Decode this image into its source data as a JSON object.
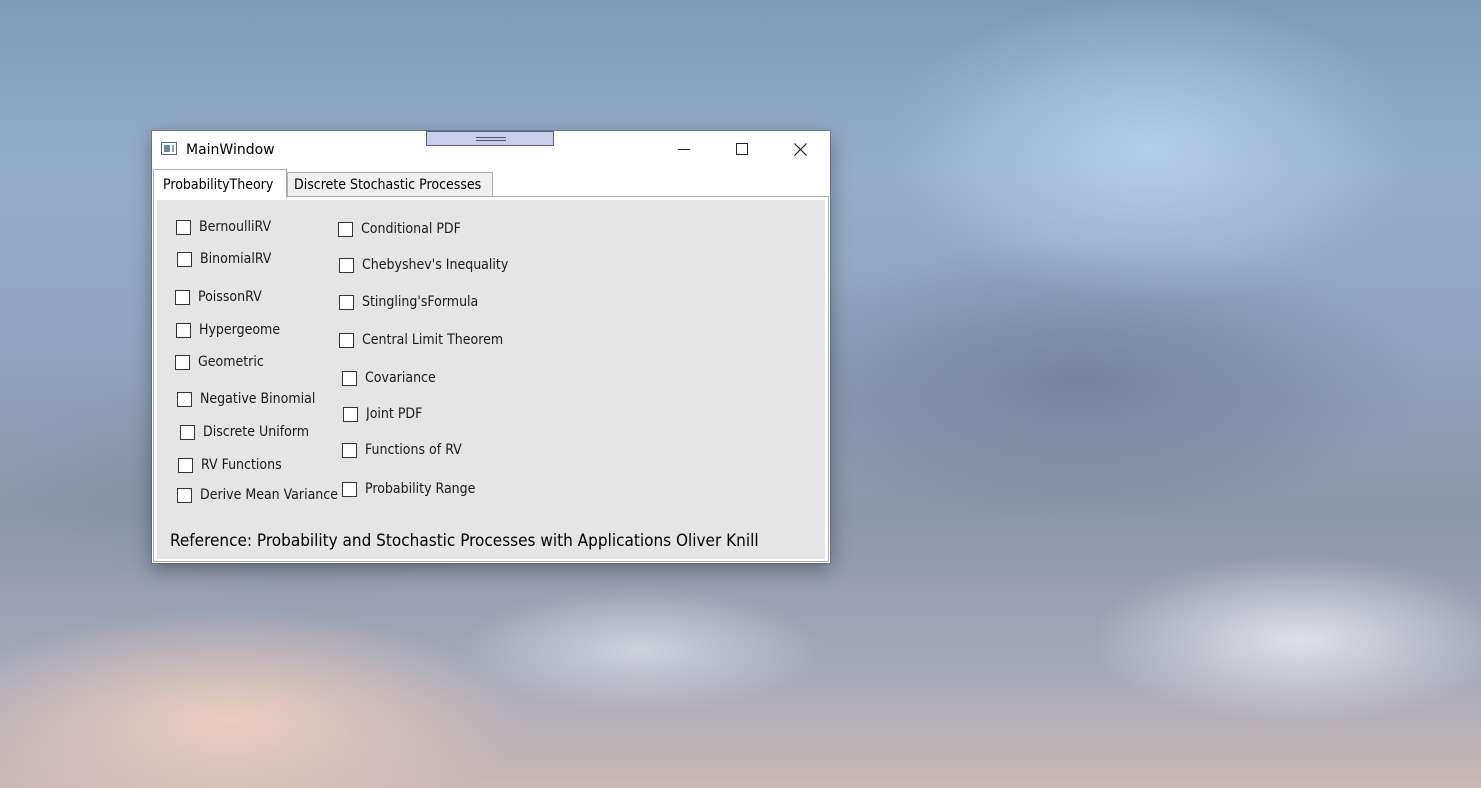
{
  "window": {
    "title": "MainWindow",
    "icon": "app-window-icon",
    "buttons": {
      "minimize": "minimize-icon",
      "maximize": "maximize-icon",
      "close": "close-icon"
    }
  },
  "tabs": [
    {
      "label": "ProbabilityTheory",
      "selected": true
    },
    {
      "label": "Discrete Stochastic Processes",
      "selected": false
    }
  ],
  "left_checkboxes": [
    {
      "label": "BernoulliRV",
      "checked": false
    },
    {
      "label": "BinomialRV",
      "checked": false
    },
    {
      "label": "PoissonRV",
      "checked": false
    },
    {
      "label": "Hypergeome",
      "checked": false
    },
    {
      "label": "Geometric",
      "checked": false
    },
    {
      "label": "Negative Binomial",
      "checked": false
    },
    {
      "label": "Discrete Uniform",
      "checked": false
    },
    {
      "label": "RV Functions",
      "checked": false
    },
    {
      "label": "Derive Mean Variance",
      "checked": false
    }
  ],
  "right_checkboxes": [
    {
      "label": "Conditional PDF",
      "checked": false
    },
    {
      "label": "Chebyshev's Inequality",
      "checked": false
    },
    {
      "label": "Stingling'sFormula",
      "checked": false
    },
    {
      "label": "Central Limit Theorem",
      "checked": false
    },
    {
      "label": "Covariance",
      "checked": false
    },
    {
      "label": "Joint PDF",
      "checked": false
    },
    {
      "label": "Functions of RV",
      "checked": false
    },
    {
      "label": "Probability Range",
      "checked": false
    }
  ],
  "reference": "Reference: Probability and Stochastic Processes with Applications Oliver Knill",
  "colors": {
    "tab_panel_background": "#e5e5e5",
    "drag_handle": "#c9cde9"
  }
}
